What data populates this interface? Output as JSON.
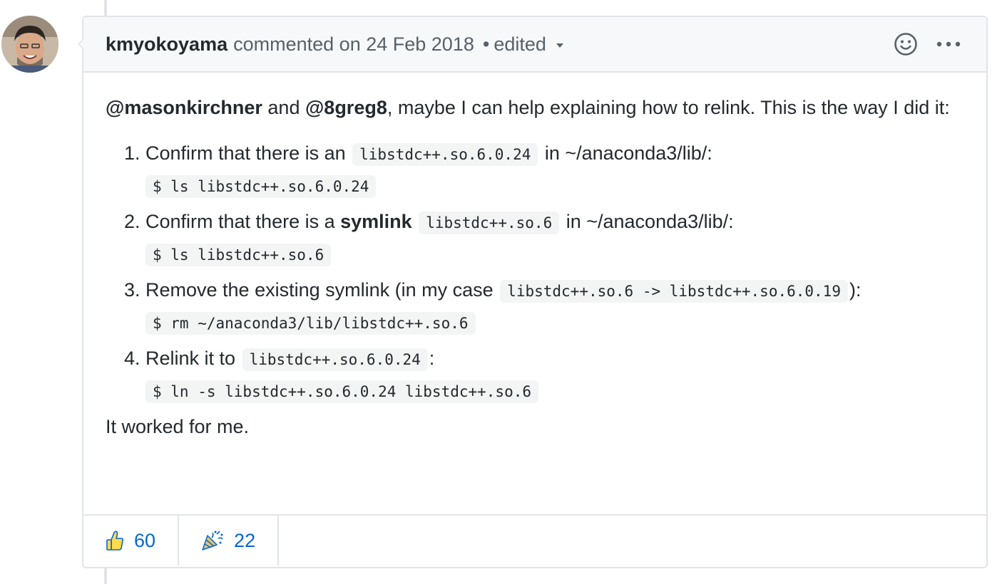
{
  "comment": {
    "author": "kmyokoyama",
    "action": "commented on",
    "date": "24 Feb 2018",
    "separator": "•",
    "edited_label": "edited"
  },
  "body": {
    "intro_mention_1": "@masonkirchner",
    "intro_and": " and ",
    "intro_mention_2": "@8greg8",
    "intro_rest": ", maybe I can help explaining how to relink. This is the way I did it:",
    "steps": [
      {
        "text_before": "Confirm that there is an ",
        "code": "libstdc++.so.6.0.24",
        "text_after": " in ~/anaconda3/lib/:",
        "command": "$ ls libstdc++.so.6.0.24"
      },
      {
        "text_before": "Confirm that there is a ",
        "bold": "symlink",
        "code": "libstdc++.so.6",
        "text_after": " in ~/anaconda3/lib/:",
        "command": "$ ls libstdc++.so.6"
      },
      {
        "text_before": "Remove the existing symlink (in my case ",
        "code": "libstdc++.so.6 -> libstdc++.so.6.0.19",
        "text_after": "):",
        "command": "$ rm ~/anaconda3/lib/libstdc++.so.6"
      },
      {
        "text_before": "Relink it to ",
        "code": "libstdc++.so.6.0.24",
        "text_after": ":",
        "command": "$ ln -s libstdc++.so.6.0.24 libstdc++.so.6"
      }
    ],
    "closing": "It worked for me."
  },
  "reactions": [
    {
      "icon": "thumbs-up-icon",
      "count": "60"
    },
    {
      "icon": "hooray-icon",
      "count": "22"
    }
  ],
  "colors": {
    "link_blue": "#0366d6",
    "header_bg": "#f6f8fa",
    "border": "#e1e4e8"
  }
}
